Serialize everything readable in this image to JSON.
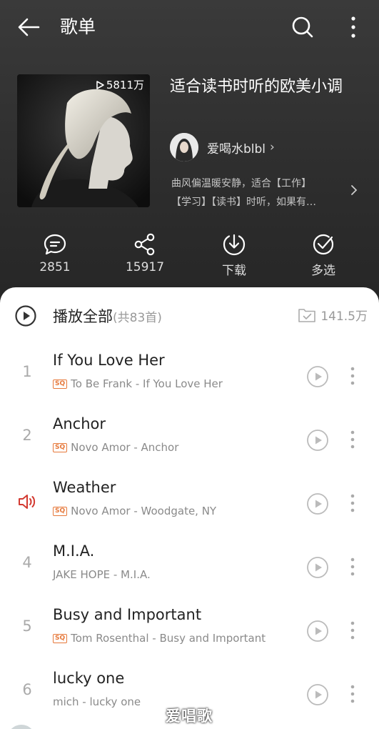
{
  "header": {
    "title": "歌单",
    "icons": {
      "back": "back-arrow-icon",
      "search": "search-icon",
      "more": "more-vertical-icon"
    }
  },
  "playlist": {
    "play_count": "5811万",
    "title": "适合读书时听的欧美小调",
    "creator": "爱喝水blbl",
    "description_line1": "曲风偏温暖安静，适合【工作】",
    "description_line2": "【学习】【读书】时听，如果有…"
  },
  "actions": [
    {
      "icon": "comment-icon",
      "label": "2851"
    },
    {
      "icon": "share-icon",
      "label": "15917"
    },
    {
      "icon": "download-icon",
      "label": "下载"
    },
    {
      "icon": "multi-select-icon",
      "label": "多选"
    }
  ],
  "play_all": {
    "label": "播放全部",
    "count": "(共83首)",
    "collect_count": "141.5万"
  },
  "songs": [
    {
      "index": "1",
      "title": "If You Love Her",
      "subtitle": "To Be Frank - If You Love Her",
      "sq": true,
      "playing": false
    },
    {
      "index": "2",
      "title": "Anchor",
      "subtitle": "Novo Amor - Anchor",
      "sq": true,
      "playing": false
    },
    {
      "index": "3",
      "title": "Weather",
      "subtitle": "Novo Amor - Woodgate, NY",
      "sq": true,
      "playing": true
    },
    {
      "index": "4",
      "title": "M.I.A.",
      "subtitle": "JAKE HOPE - M.I.A.",
      "sq": false,
      "playing": false
    },
    {
      "index": "5",
      "title": "Busy and Important",
      "subtitle": "Tom Rosenthal - Busy and Important",
      "sq": true,
      "playing": false
    },
    {
      "index": "6",
      "title": "lucky one",
      "subtitle": "mich - lucky one",
      "sq": false,
      "playing": false
    }
  ],
  "sq_badge": "SQ",
  "watermark": "爱唱歌",
  "colors": {
    "accent_red": "#d33a31",
    "sq_orange": "#e6783a",
    "header_bg": "#333333"
  }
}
